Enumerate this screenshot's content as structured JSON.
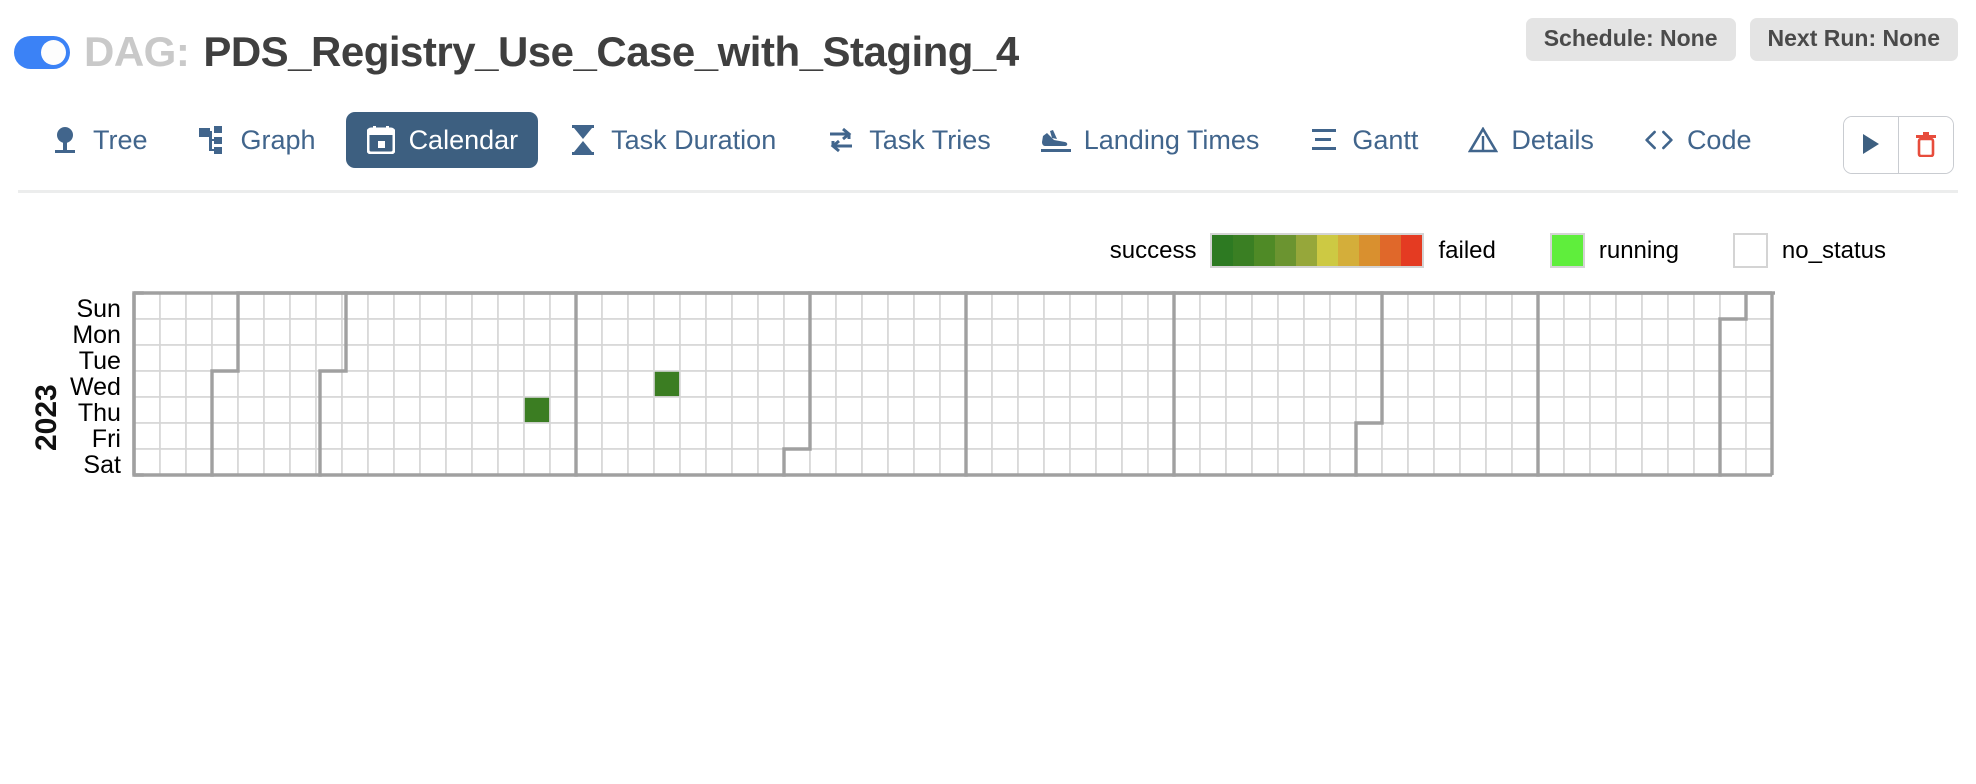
{
  "header": {
    "toggle": {
      "name": "dag-paused-toggle",
      "state": "on"
    },
    "dag_prefix": "DAG:",
    "dag_name": "PDS_Registry_Use_Case_with_Staging_4",
    "badges": [
      {
        "label": "Schedule: None"
      },
      {
        "label": "Next Run: None"
      }
    ]
  },
  "tabs": [
    {
      "label": "Tree",
      "icon": "tree-icon",
      "active": false
    },
    {
      "label": "Graph",
      "icon": "graph-icon",
      "active": false
    },
    {
      "label": "Calendar",
      "icon": "calendar-icon",
      "active": true
    },
    {
      "label": "Task Duration",
      "icon": "hourglass-icon",
      "active": false
    },
    {
      "label": "Task Tries",
      "icon": "retry-icon",
      "active": false
    },
    {
      "label": "Landing Times",
      "icon": "plane-landing-icon",
      "active": false
    },
    {
      "label": "Gantt",
      "icon": "gantt-icon",
      "active": false
    },
    {
      "label": "Details",
      "icon": "details-triangle-icon",
      "active": false
    },
    {
      "label": "Code",
      "icon": "code-brackets-icon",
      "active": false
    }
  ],
  "actions": {
    "trigger": {
      "label": "Trigger DAG",
      "icon": "play-icon",
      "color": "#3d5f80"
    },
    "delete": {
      "label": "Delete DAG",
      "icon": "trash-icon",
      "color": "#e74c3c"
    }
  },
  "legend": {
    "success_label": "success",
    "failed_label": "failed",
    "running_label": "running",
    "no_status_label": "no_status",
    "ramp_colors": [
      "#2d7a22",
      "#3a7f23",
      "#4f8a26",
      "#6b9430",
      "#96a73a",
      "#cdc943",
      "#d4ae3a",
      "#d9902f",
      "#e0682a",
      "#e43b22"
    ],
    "running_color": "#5fee3c",
    "no_status_color": "#ffffff",
    "border_color": "#d4d4d4"
  },
  "calendar": {
    "year": "2023",
    "day_labels": [
      "Sun",
      "Mon",
      "Tue",
      "Wed",
      "Thu",
      "Fri",
      "Sat"
    ],
    "cell_size": 26,
    "weeks": 63,
    "grid_line_color": "#d6d6d6",
    "month_line_color": "#a0a0a0",
    "empty_color": "#ffffff",
    "events": [
      {
        "week": 15,
        "day": 4,
        "color": "#3b7d22",
        "status": "success"
      },
      {
        "week": 20,
        "day": 3,
        "color": "#3b7d22",
        "status": "success"
      }
    ],
    "month_paths": [
      "M 8,0 H 0 V 182 H 8",
      "M 212,0 H 104 V 78 H 78 V 182",
      "M 442,0 H 212 V 78 H 186 V 182",
      "M 676,0 H 442 V 182",
      "M 832,0 H 676 V 156 H 650 V 182",
      "M 1040,0 H 832 V 182",
      "M 1248,0 H 1040 V 182",
      "M 1404,0 H 1248 V 130 H 1222 V 182",
      "M 1612,0 H 1404 V 182",
      "M 1768,0 H 1612 V 26 H 1586 V 182",
      "M 1846,0 H 1768 V 182",
      "M 1872,0 H 1846 V 26 H 1820 V 182"
    ]
  }
}
